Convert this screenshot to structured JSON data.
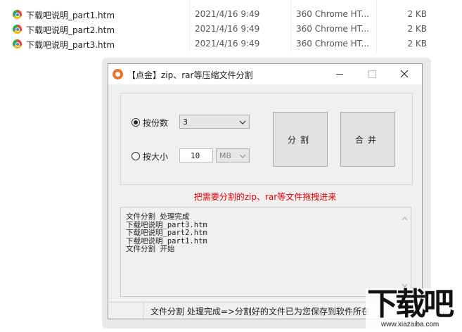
{
  "files": [
    {
      "name": "下载吧说明_part1.htm",
      "date": "2021/4/16 9:49",
      "type": "360 Chrome HT...",
      "size": "2 KB"
    },
    {
      "name": "下载吧说明_part2.htm",
      "date": "2021/4/16 9:49",
      "type": "360 Chrome HT...",
      "size": "2 KB"
    },
    {
      "name": "下载吧说明_part3.htm",
      "date": "2021/4/16 9:49",
      "type": "360 Chrome HT...",
      "size": "2 KB"
    }
  ],
  "window": {
    "title": "【点金】zip、rar等压缩文件分割",
    "minimize": "—",
    "close": "✕"
  },
  "options": {
    "by_count_label": "按份数",
    "by_count_value": "3",
    "by_size_label": "按大小",
    "by_size_value": "10",
    "size_unit": "MB",
    "selected": "by_count"
  },
  "buttons": {
    "split": "分割",
    "merge": "合并"
  },
  "hint": "把需要分割的zip、rar等文件拖拽进来",
  "log_lines": [
    "文件分割 处理完成",
    "下载吧说明_part3.htm",
    "下载吧说明_part2.htm",
    "下载吧说明_part1.htm",
    "文件分割 开始"
  ],
  "status_text": "文件分割 处理完成=>分割好的文件已为您保存到软件所在",
  "watermark": {
    "logo": "下载吧",
    "url": "www.xiazaiba.com"
  }
}
